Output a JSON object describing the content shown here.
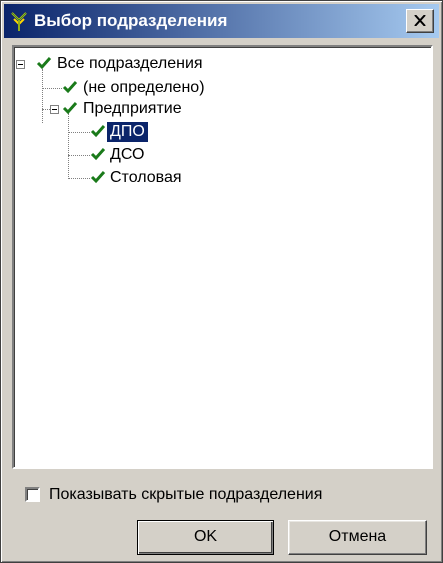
{
  "window": {
    "title": "Выбор подразделения",
    "close_icon": "close-icon"
  },
  "tree": {
    "root": {
      "label": "Все подразделения",
      "checked": true,
      "expanded": true
    },
    "children": [
      {
        "label": "(не определено)",
        "checked": true
      },
      {
        "label": "Предприятие",
        "checked": true,
        "expanded": true,
        "children": [
          {
            "label": "ДПО",
            "checked": true,
            "selected": true
          },
          {
            "label": "ДСО",
            "checked": true
          },
          {
            "label": "Столовая",
            "checked": true
          }
        ]
      }
    ]
  },
  "show_hidden": {
    "label": "Показывать скрытые подразделения",
    "checked": false
  },
  "buttons": {
    "ok": "OK",
    "cancel": "Отмена"
  },
  "colors": {
    "titlebar": "#0a246a",
    "check": "#1a7a1a",
    "selection": "#0a246a",
    "face": "#d4d0c8"
  }
}
